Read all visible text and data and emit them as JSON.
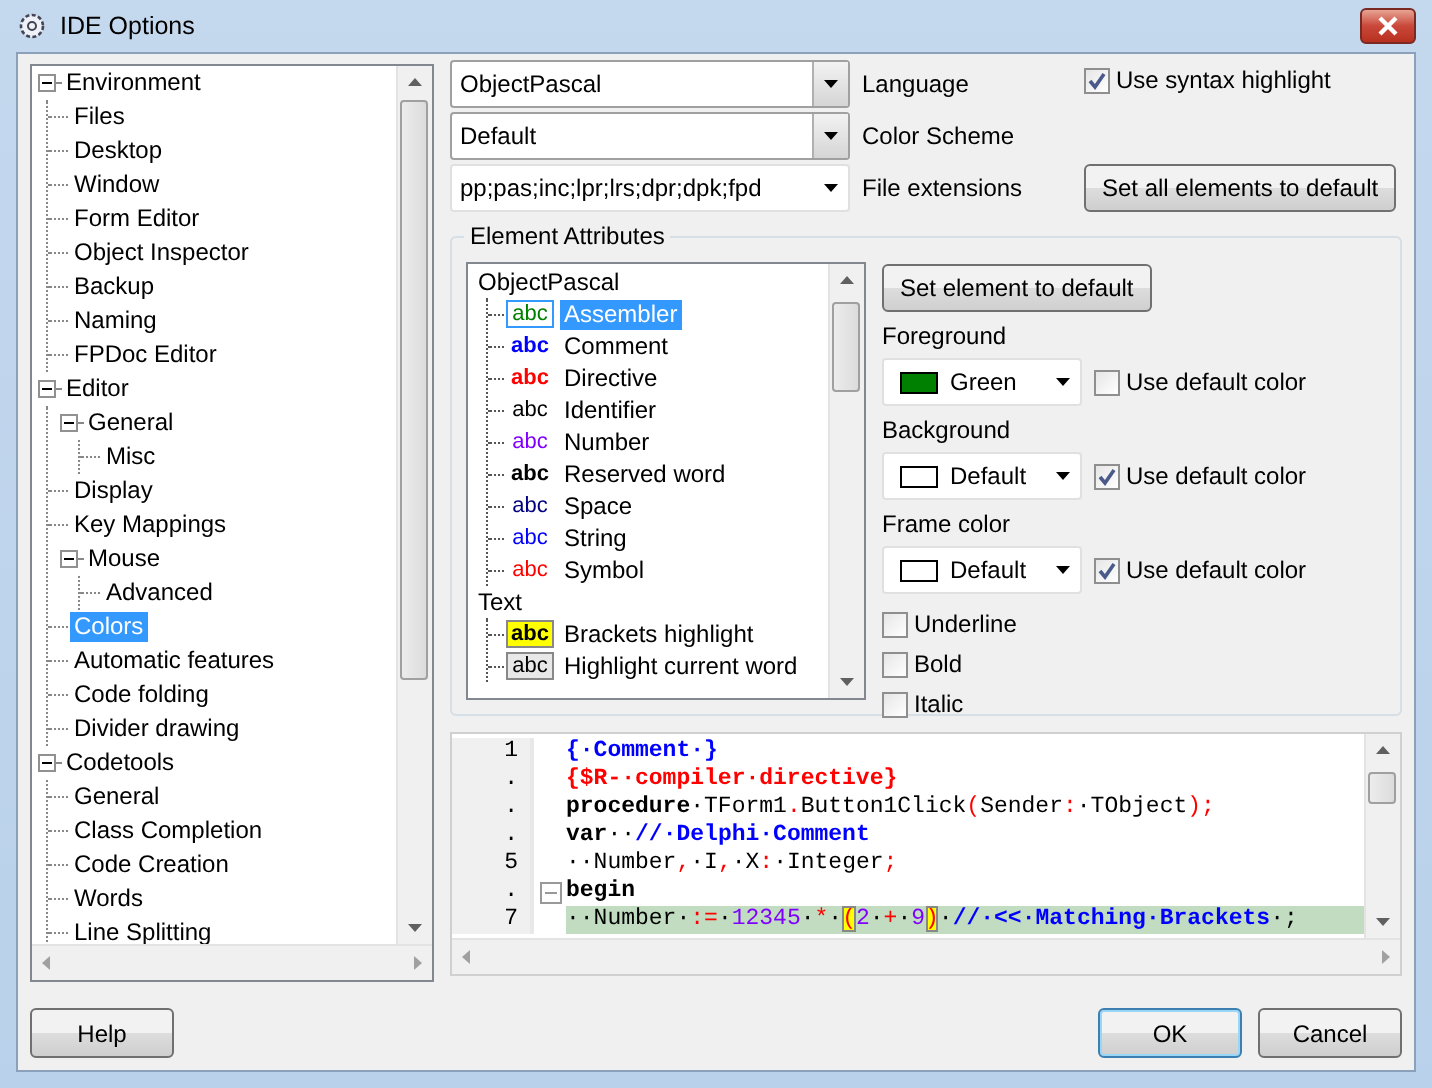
{
  "window": {
    "title": "IDE Options"
  },
  "tree": [
    {
      "label": "Environment",
      "selected": false,
      "expanded": true,
      "children": [
        {
          "label": "Files",
          "selected": false
        },
        {
          "label": "Desktop",
          "selected": false
        },
        {
          "label": "Window",
          "selected": false
        },
        {
          "label": "Form Editor",
          "selected": false
        },
        {
          "label": "Object Inspector",
          "selected": false
        },
        {
          "label": "Backup",
          "selected": false
        },
        {
          "label": "Naming",
          "selected": false
        },
        {
          "label": "FPDoc Editor",
          "selected": false
        }
      ]
    },
    {
      "label": "Editor",
      "selected": false,
      "expanded": true,
      "children": [
        {
          "label": "General",
          "selected": false,
          "expanded": true,
          "children": [
            {
              "label": "Misc",
              "selected": false
            }
          ]
        },
        {
          "label": "Display",
          "selected": false
        },
        {
          "label": "Key Mappings",
          "selected": false
        },
        {
          "label": "Mouse",
          "selected": false,
          "expanded": true,
          "children": [
            {
              "label": "Advanced",
              "selected": false
            }
          ]
        },
        {
          "label": "Colors",
          "selected": true
        },
        {
          "label": "Automatic features",
          "selected": false
        },
        {
          "label": "Code folding",
          "selected": false
        },
        {
          "label": "Divider drawing",
          "selected": false
        }
      ]
    },
    {
      "label": "Codetools",
      "selected": false,
      "expanded": true,
      "children": [
        {
          "label": "General",
          "selected": false
        },
        {
          "label": "Class Completion",
          "selected": false
        },
        {
          "label": "Code Creation",
          "selected": false
        },
        {
          "label": "Words",
          "selected": false
        },
        {
          "label": "Line Splitting",
          "selected": false
        }
      ]
    }
  ],
  "language": {
    "value": "ObjectPascal",
    "label": "Language"
  },
  "color_scheme": {
    "value": "Default",
    "label": "Color Scheme"
  },
  "file_extensions": {
    "value": "pp;pas;inc;lpr;lrs;dpr;dpk;fpd",
    "label": "File extensions"
  },
  "use_syntax_highlight": {
    "label": "Use syntax highlight",
    "checked": true
  },
  "set_all_button": "Set all elements to default",
  "element_attributes": {
    "title": "Element Attributes",
    "groups": [
      {
        "label": "ObjectPascal",
        "items": [
          {
            "sample": "abc",
            "label": "Assembler",
            "color": "#008000",
            "bold": false,
            "selected": true
          },
          {
            "sample": "abc",
            "label": "Comment",
            "color": "#0000ff",
            "bold": true,
            "selected": false
          },
          {
            "sample": "abc",
            "label": "Directive",
            "color": "#ff0000",
            "bold": true,
            "selected": false
          },
          {
            "sample": "abc",
            "label": "Identifier",
            "color": "#000000",
            "bold": false,
            "selected": false
          },
          {
            "sample": "abc",
            "label": "Number",
            "color": "#8000ff",
            "bold": false,
            "selected": false
          },
          {
            "sample": "abc",
            "label": "Reserved word",
            "color": "#000000",
            "bold": true,
            "selected": false
          },
          {
            "sample": "abc",
            "label": "Space",
            "color": "#000080",
            "bold": false,
            "selected": false
          },
          {
            "sample": "abc",
            "label": "String",
            "color": "#0000ff",
            "bold": false,
            "selected": false
          },
          {
            "sample": "abc",
            "label": "Symbol",
            "color": "#ff0000",
            "bold": false,
            "selected": false
          }
        ]
      },
      {
        "label": "Text",
        "items": [
          {
            "kind": "boxed",
            "sample": "abc",
            "label": "Brackets highlight",
            "color": "#ffff00",
            "bold": true,
            "selected": false
          },
          {
            "kind": "boxed",
            "sample": "abc",
            "label": "Highlight current word",
            "color": "#e8e8e8",
            "bold": false,
            "selected": false
          }
        ]
      }
    ],
    "set_element_button": "Set element to default",
    "colors": [
      {
        "label": "Foreground",
        "value": "Green",
        "color": "#008000",
        "default_label": "Use default color",
        "use_default": false
      },
      {
        "label": "Background",
        "value": "Default",
        "color": "#ffffff",
        "default_label": "Use default color",
        "use_default": true
      },
      {
        "label": "Frame color",
        "value": "Default",
        "color": "#ffffff",
        "default_label": "Use default color",
        "use_default": true
      }
    ],
    "styles": [
      {
        "label": "Underline",
        "checked": false
      },
      {
        "label": "Bold",
        "checked": false
      },
      {
        "label": "Italic",
        "checked": false
      }
    ]
  },
  "preview": {
    "lines": [
      {
        "number": "1",
        "current": false,
        "fold": false,
        "tokens": [
          {
            "t": "{·Comment·}",
            "kind": "comment"
          }
        ]
      },
      {
        "number": ".",
        "current": false,
        "fold": false,
        "tokens": [
          {
            "t": "{$R-·compiler·directive}",
            "kind": "directive"
          }
        ]
      },
      {
        "number": ".",
        "current": false,
        "fold": false,
        "tokens": [
          {
            "t": "procedure",
            "kind": "keyword"
          },
          {
            "t": "·TForm1",
            "kind": "ident"
          },
          {
            "t": ".",
            "kind": "symbol"
          },
          {
            "t": "Button1Click",
            "kind": "ident"
          },
          {
            "t": "(",
            "kind": "symbol"
          },
          {
            "t": "Sender",
            "kind": "ident"
          },
          {
            "t": ":",
            "kind": "symbol"
          },
          {
            "t": "·TObject",
            "kind": "ident"
          },
          {
            "t": ");",
            "kind": "symbol"
          }
        ]
      },
      {
        "number": ".",
        "current": false,
        "fold": false,
        "tokens": [
          {
            "t": "var",
            "kind": "keyword"
          },
          {
            "t": "··",
            "kind": "ident"
          },
          {
            "t": "//·Delphi·Comment",
            "kind": "comment"
          }
        ]
      },
      {
        "number": "5",
        "current": false,
        "fold": false,
        "tokens": [
          {
            "t": "··Number",
            "kind": "ident"
          },
          {
            "t": ",",
            "kind": "symbol"
          },
          {
            "t": "·I",
            "kind": "ident"
          },
          {
            "t": ",",
            "kind": "symbol"
          },
          {
            "t": "·X",
            "kind": "ident"
          },
          {
            "t": ":",
            "kind": "symbol"
          },
          {
            "t": "·Integer",
            "kind": "ident"
          },
          {
            "t": ";",
            "kind": "symbol"
          }
        ]
      },
      {
        "number": ".",
        "current": false,
        "fold": true,
        "tokens": [
          {
            "t": "begin",
            "kind": "keyword"
          }
        ]
      },
      {
        "number": "7",
        "current": true,
        "fold": false,
        "tokens": [
          {
            "t": "··Number·",
            "kind": "ident"
          },
          {
            "t": ":=",
            "kind": "symbol"
          },
          {
            "t": "·",
            "kind": "ident"
          },
          {
            "t": "12345",
            "kind": "number"
          },
          {
            "t": "·",
            "kind": "ident"
          },
          {
            "t": "*",
            "kind": "symbol"
          },
          {
            "t": "·",
            "kind": "ident"
          },
          {
            "t": "(",
            "kind": "bracket"
          },
          {
            "t": "2",
            "kind": "number"
          },
          {
            "t": "·",
            "kind": "ident"
          },
          {
            "t": "+",
            "kind": "symbol"
          },
          {
            "t": "·",
            "kind": "ident"
          },
          {
            "t": "9",
            "kind": "number"
          },
          {
            "t": ")",
            "kind": "bracket"
          },
          {
            "t": "·",
            "kind": "ident"
          },
          {
            "t": "//·<<·Matching·Brackets",
            "kind": "comment"
          },
          {
            "t": "·;",
            "kind": "ident"
          }
        ]
      }
    ]
  },
  "buttons": {
    "help": "Help",
    "ok": "OK",
    "cancel": "Cancel"
  }
}
